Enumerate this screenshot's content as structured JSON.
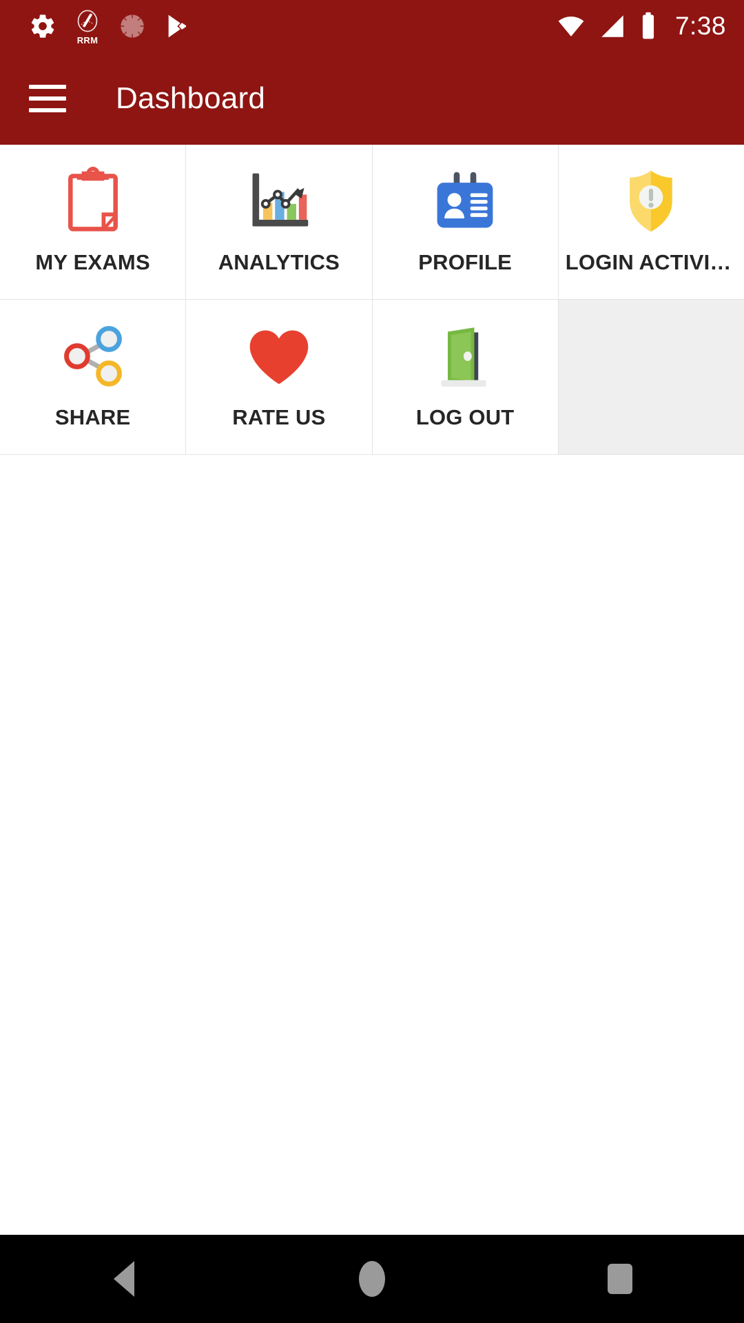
{
  "status_bar": {
    "icons": [
      "settings-gear-icon",
      "rrm-gauge-icon",
      "sync-circle-icon",
      "play-store-icon"
    ],
    "rrm_label": "RRM",
    "right_icons": [
      "wifi-icon",
      "cellular-signal-icon",
      "battery-icon"
    ],
    "time": "7:38",
    "background_color": "#8E1512"
  },
  "app_bar": {
    "menu_icon": "hamburger-menu-icon",
    "title": "Dashboard",
    "background_color": "#8E1512",
    "text_color": "#FFFFFF"
  },
  "grid": {
    "columns": 4,
    "items": [
      {
        "label": "MY EXAMS",
        "icon": "clipboard-icon",
        "color": "#E8534A",
        "empty": false,
        "truncated": false
      },
      {
        "label": "ANALYTICS",
        "icon": "bar-chart-icon",
        "color": "#4A4A4A",
        "empty": false,
        "truncated": false
      },
      {
        "label": "PROFILE",
        "icon": "id-badge-icon",
        "color": "#3A76D8",
        "empty": false,
        "truncated": false
      },
      {
        "label": "LOGIN ACTIVI…",
        "icon": "shield-alert-icon",
        "color": "#F9C92C",
        "empty": false,
        "truncated": true
      },
      {
        "label": "SHARE",
        "icon": "share-nodes-icon",
        "color": "#E03B2F",
        "empty": false,
        "truncated": false
      },
      {
        "label": "RATE US",
        "icon": "heart-icon",
        "color": "#E8402F",
        "empty": false,
        "truncated": false
      },
      {
        "label": "LOG OUT",
        "icon": "exit-door-icon",
        "color": "#77B843",
        "empty": false,
        "truncated": false
      },
      {
        "label": "",
        "icon": "",
        "color": "#EFEFEF",
        "empty": true,
        "truncated": false
      }
    ]
  },
  "nav_bar": {
    "back_label": "back-button",
    "home_label": "home-button",
    "recents_label": "recents-button",
    "background_color": "#000000",
    "icon_color": "#9A9A9A"
  }
}
